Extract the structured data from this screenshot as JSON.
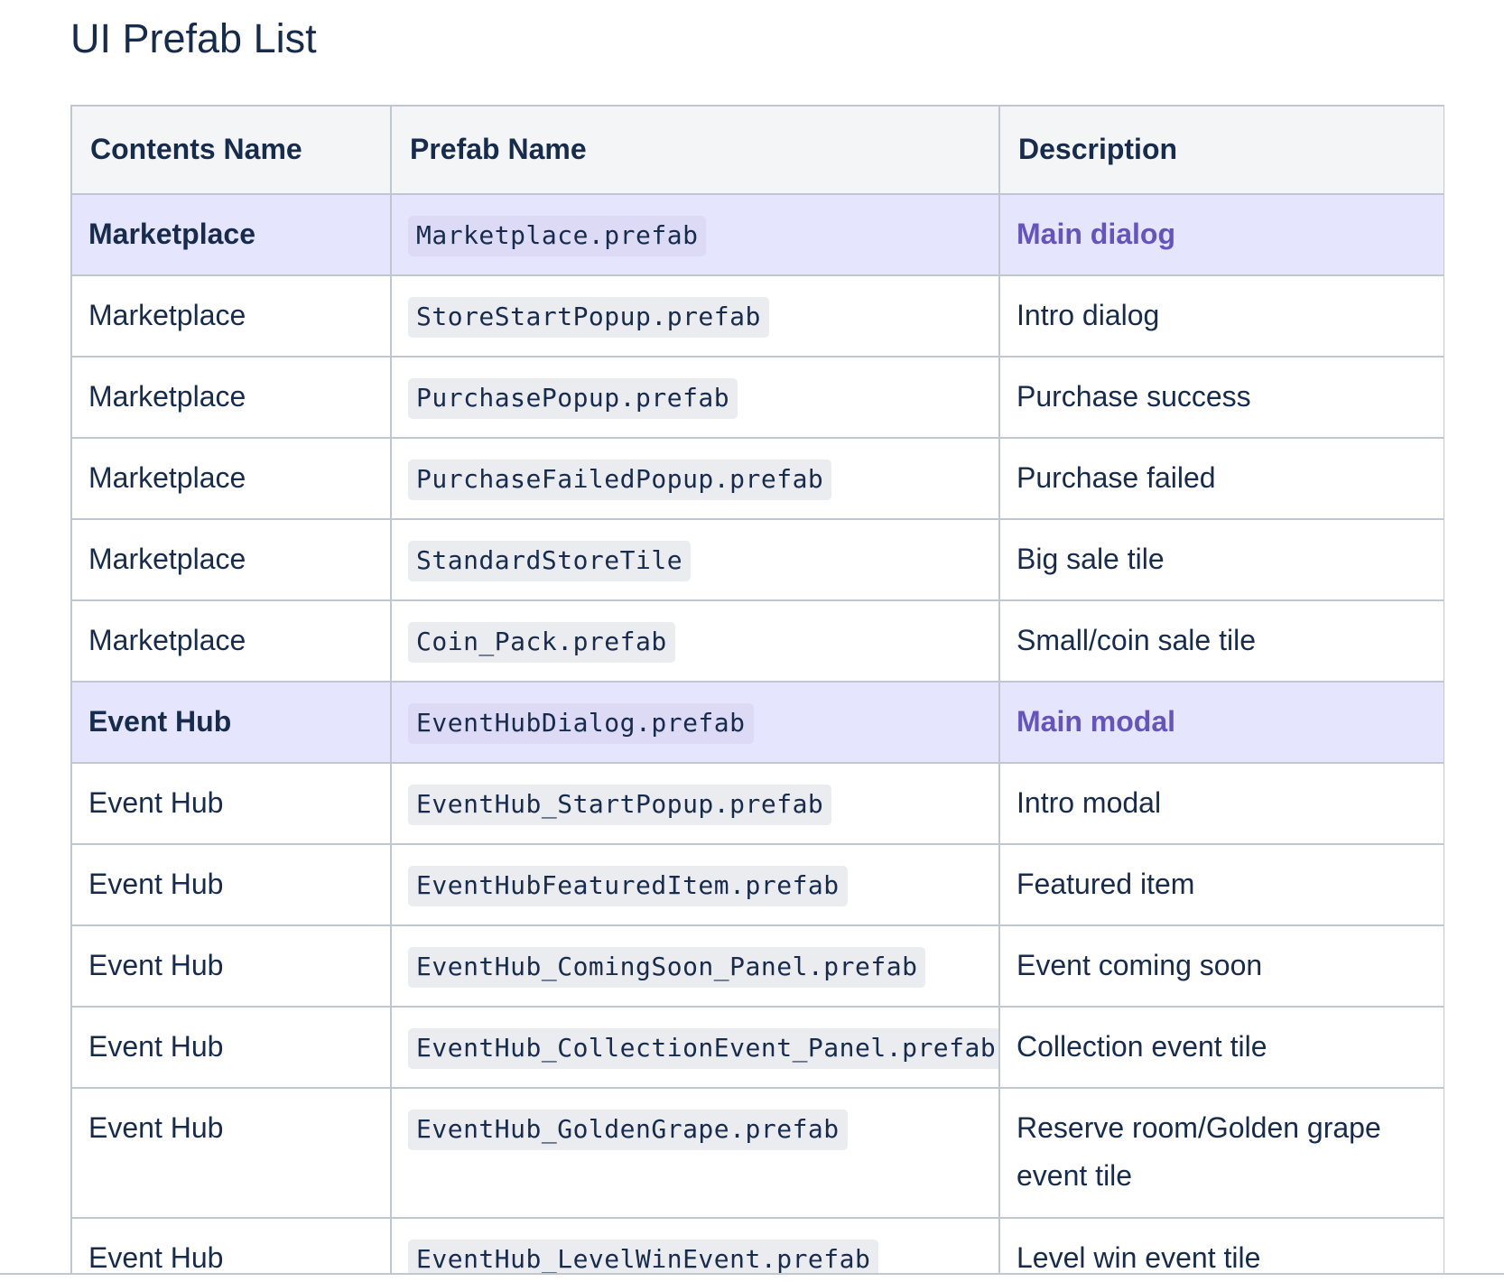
{
  "page": {
    "title": "UI Prefab List"
  },
  "table": {
    "headers": [
      "Contents Name",
      "Prefab Name",
      "Description"
    ],
    "rows": [
      {
        "contents": "Marketplace",
        "prefab": "Marketplace.prefab",
        "description": "Main dialog",
        "highlight": true
      },
      {
        "contents": "Marketplace",
        "prefab": "StoreStartPopup.prefab",
        "description": "Intro dialog",
        "highlight": false
      },
      {
        "contents": "Marketplace",
        "prefab": "PurchasePopup.prefab",
        "description": "Purchase success",
        "highlight": false
      },
      {
        "contents": "Marketplace",
        "prefab": "PurchaseFailedPopup.prefab",
        "description": "Purchase failed",
        "highlight": false
      },
      {
        "contents": "Marketplace",
        "prefab": "StandardStoreTile",
        "description": "Big sale tile",
        "highlight": false
      },
      {
        "contents": "Marketplace",
        "prefab": "Coin_Pack.prefab",
        "description": "Small/coin sale tile",
        "highlight": false
      },
      {
        "contents": "Event Hub",
        "prefab": "EventHubDialog.prefab",
        "description": "Main modal",
        "highlight": true
      },
      {
        "contents": "Event Hub",
        "prefab": "EventHub_StartPopup.prefab",
        "description": "Intro modal",
        "highlight": false
      },
      {
        "contents": "Event Hub",
        "prefab": "EventHubFeaturedItem.prefab",
        "description": "Featured item",
        "highlight": false
      },
      {
        "contents": "Event Hub",
        "prefab": "EventHub_ComingSoon_Panel.prefab",
        "description": "Event coming soon",
        "highlight": false
      },
      {
        "contents": "Event Hub",
        "prefab": "EventHub_CollectionEvent_Panel.prefab",
        "description": "Collection event tile",
        "highlight": false
      },
      {
        "contents": "Event Hub",
        "prefab": "EventHub_GoldenGrape.prefab",
        "description": "Reserve room/Golden grape event tile",
        "highlight": false
      },
      {
        "contents": "Event Hub",
        "prefab": "EventHub_LevelWinEvent.prefab",
        "description": "Level win event tile",
        "highlight": false
      }
    ]
  },
  "colors": {
    "text": "#172b4d",
    "header_bg": "#f4f5f7",
    "highlight_bg": "#e6e5fe",
    "highlight_text": "#6554c0",
    "border": "#c1c7d0",
    "code_bg": "#ebecf0"
  }
}
